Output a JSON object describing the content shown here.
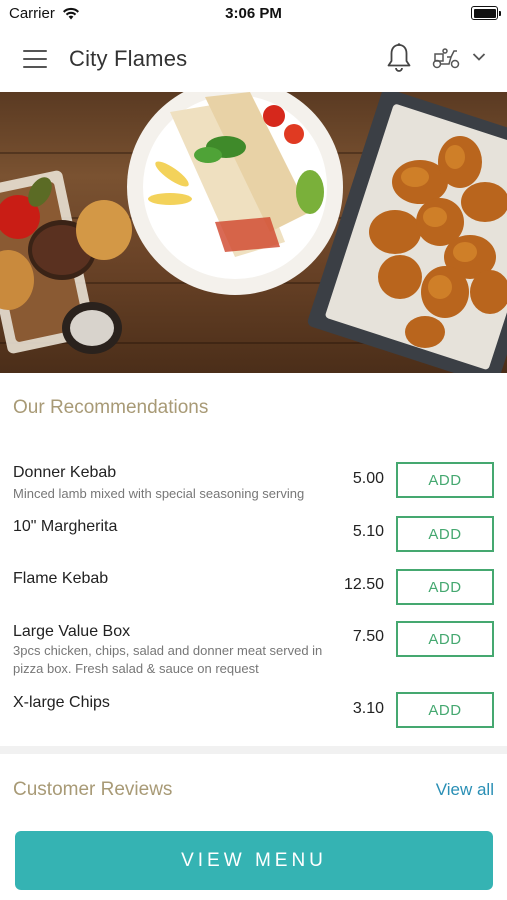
{
  "status_bar": {
    "carrier": "Carrier",
    "time": "3:06 PM"
  },
  "header": {
    "title": "City Flames",
    "icons": [
      "menu-icon",
      "bell-icon",
      "delivery-scooter-icon",
      "chevron-down-icon"
    ]
  },
  "hero": {
    "image": "food-spread-kebab-wrap-burgers-fried-chicken"
  },
  "recommendations": {
    "title": "Our Recommendations",
    "items": [
      {
        "name": "Donner Kebab",
        "desc": "Minced lamb mixed with special seasoning serving",
        "price": "5.00",
        "button": "ADD"
      },
      {
        "name": "10\" Margherita",
        "desc": "",
        "price": "5.10",
        "button": "ADD"
      },
      {
        "name": "Flame Kebab",
        "desc": "",
        "price": "12.50",
        "button": "ADD"
      },
      {
        "name": "Large Value Box",
        "desc": "3pcs chicken, chips, salad and donner meat served in pizza box. Fresh salad & sauce on request",
        "price": "7.50",
        "button": "ADD"
      },
      {
        "name": "X-large Chips",
        "desc": "",
        "price": "3.10",
        "button": "ADD"
      }
    ]
  },
  "reviews": {
    "title": "Customer Reviews",
    "view_all": "View all"
  },
  "footer": {
    "view_menu": "VIEW MENU"
  },
  "colors": {
    "accent_teal": "#35b3b3",
    "add_green": "#45a870",
    "section_title": "#a89a76",
    "link_blue": "#2a8fb5"
  }
}
